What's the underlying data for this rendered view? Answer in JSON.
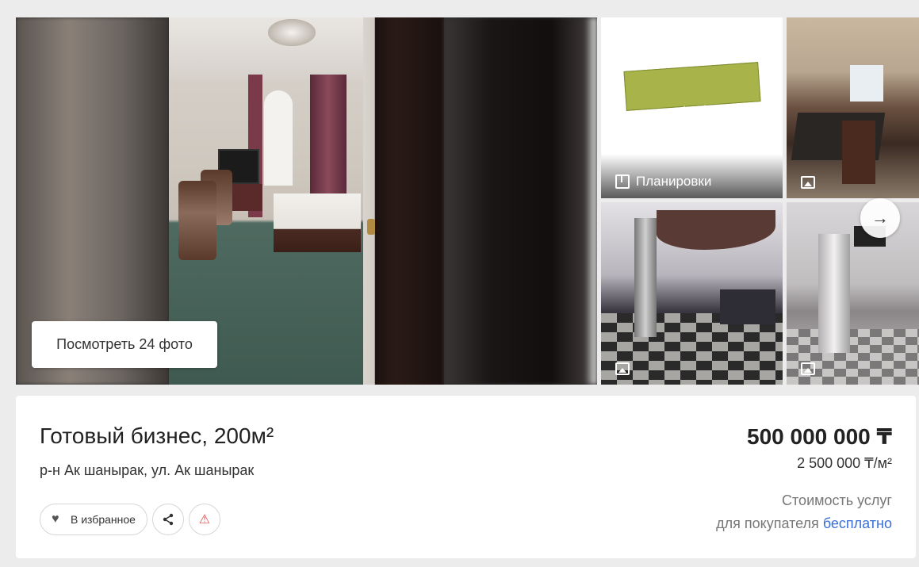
{
  "gallery": {
    "view_photos_label": "Посмотреть 24 фото",
    "plan_label": "Планировки",
    "plan_watermark": "etagi",
    "next_icon": "→",
    "image_icon": "image-icon"
  },
  "listing": {
    "title": "Готовый бизнес, 200м²",
    "address": "р-н Ак шанырак, ул. Ак шанырак",
    "price": "500 000 000 ₸",
    "price_per_sqm": "2 500 000 ₸/м²",
    "services_line1": "Стоимость услуг",
    "services_line2_prefix": "для покупателя",
    "services_line2_link": "бесплатно"
  },
  "actions": {
    "favorite_label": "В избранное",
    "heart_icon": "♥",
    "share_icon": "⋖",
    "warning_icon": "⚠"
  },
  "colors": {
    "accent_link": "#3a6fd8",
    "warning": "#e04848"
  }
}
